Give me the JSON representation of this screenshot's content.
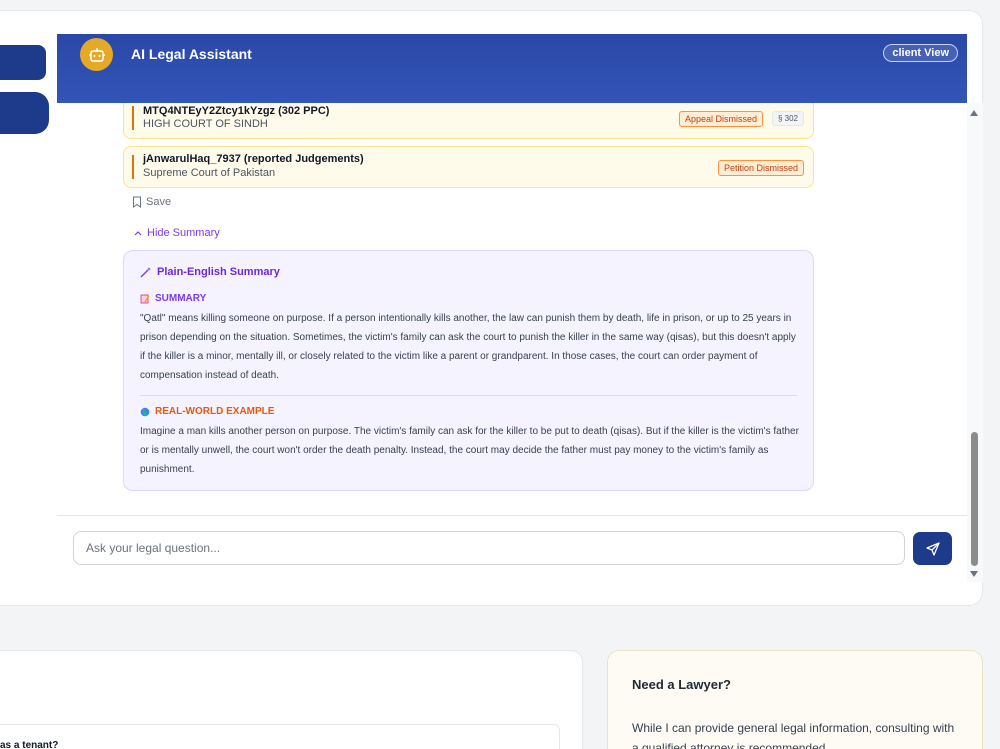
{
  "header": {
    "title": "AI Legal Assistant",
    "view_badge": "client View"
  },
  "cases": [
    {
      "title": "MTQ4NTEyY2Ztcy1kYzgz (302 PPC)",
      "court": "HIGH COURT OF SINDH",
      "status": "Appeal Dismissed",
      "section": "§ 302"
    },
    {
      "title": "jAnwarulHaq_7937 (reported Judgements)",
      "court": "Supreme Court of Pakistan",
      "status": "Petition Dismissed"
    }
  ],
  "actions": {
    "save_label": "Save",
    "hide_summary_label": "Hide Summary"
  },
  "summary": {
    "heading": "Plain-English Summary",
    "summary_label": "SUMMARY",
    "summary_text": "\"Qatl\" means killing someone on purpose. If a person intentionally kills another, the law can punish them by death, life in prison, or up to 25 years in prison depending on the situation. Sometimes, the victim's family can ask the court to punish the killer in the same way (qisas), but this doesn't apply if the killer is a minor, mentally ill, or closely related to the victim like a parent or grandparent. In those cases, the court can order payment of compensation instead of death.",
    "example_label": "REAL-WORLD EXAMPLE",
    "example_text": "Imagine a man kills another person on purpose. The victim's family can ask for the killer to be put to death (qisas). But if the killer is the victim's father or is mentally unwell, the court won't order the death penalty. Instead, the court may decide the father must pay money to the victim's family as punishment."
  },
  "input": {
    "placeholder": "Ask your legal question..."
  },
  "faq": {
    "partial_question": "as a tenant?"
  },
  "lawyer_card": {
    "title": "Need a Lawyer?",
    "text": "While I can provide general legal information, consulting with a qualified attorney is recommended."
  },
  "colors": {
    "brand_navy": "#1e3a8a",
    "header_blue": "#2a48a6",
    "bot_avatar": "#e4a927",
    "summary_purple": "#7c3aed",
    "example_orange": "#ea580c"
  }
}
